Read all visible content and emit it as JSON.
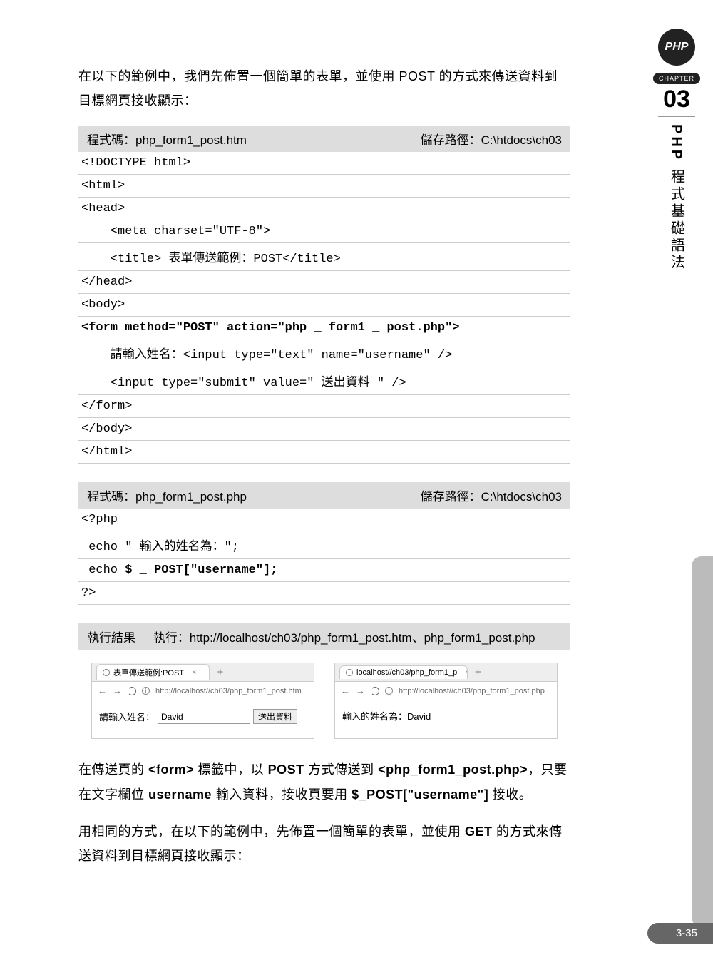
{
  "sidebar": {
    "badge": "PHP",
    "chapter_label": "CHAPTER",
    "chapter_num": "03",
    "vtitle_php": "PHP",
    "vtitle_rest": " 程式基礎語法"
  },
  "intro": "在以下的範例中，我們先佈置一個簡單的表單，並使用 POST 的方式來傳送資料到目標網頁接收顯示：",
  "block1": {
    "header_left": "程式碼：php_form1_post.htm",
    "header_right": "儲存路徑：C:\\htdocs\\ch03",
    "lines": [
      "<!DOCTYPE html>",
      "<html>",
      "<head>",
      "    <meta charset=\"UTF-8\">",
      "    <title> 表單傳送範例：POST</title>",
      "</head>",
      "<body>",
      "<form method=\"POST\" action=\"php _ form1 _ post.php\">",
      "    請輸入姓名：<input type=\"text\" name=\"username\" />",
      "    <input type=\"submit\" value=\" 送出資料 \" />",
      "</form>",
      "</body>",
      "</html>"
    ],
    "bold_lines": [
      7
    ]
  },
  "block2": {
    "header_left": "程式碼：php_form1_post.php",
    "header_right": "儲存路徑：C:\\htdocs\\ch03",
    "lines": [
      "<?php",
      " echo \" 輸入的姓名為：\";",
      " echo $ _ POST[\"username\"];",
      "?>"
    ],
    "bold_segments": {
      "2": "$ _ POST[\"username\"];"
    }
  },
  "result": {
    "label": "執行結果",
    "run_label": "執行：",
    "run_text": "http://localhost/ch03/php_form1_post.htm、php_form1_post.php"
  },
  "browser1": {
    "tab_title": "表單傳送範例:POST",
    "url": "http://localhost//ch03/php_form1_post.htm",
    "form_label": "請輸入姓名：",
    "input_value": "David",
    "submit_label": "送出資料"
  },
  "browser2": {
    "tab_title": "localhost//ch03/php_form1_p",
    "url": "http://localhost//ch03/php_form1_post.php",
    "output": "輸入的姓名為：David"
  },
  "para1_parts": [
    "在傳送頁的 ",
    "<form>",
    " 標籤中，以 ",
    "POST",
    " 方式傳送到 ",
    "<php_form1_post.php>",
    "，只要在文字欄位 ",
    "username",
    " 輸入資料，接收頁要用 ",
    "$_POST[\"username\"]",
    " 接收。"
  ],
  "para2_parts": [
    "用相同的方式，在以下的範例中，先佈置一個簡單的表單，並使用 ",
    "GET",
    " 的方式來傳送資料到目標網頁接收顯示："
  ],
  "page_number": "3-35"
}
